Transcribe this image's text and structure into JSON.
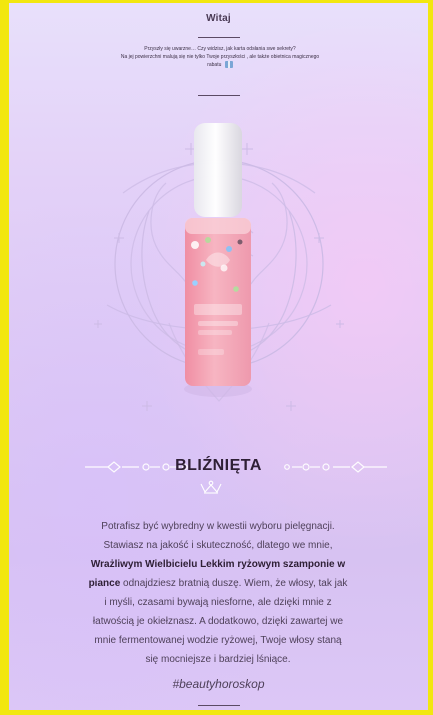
{
  "email": {
    "title": "Witaj",
    "intro_line1": "Przyszły się uwarzne… Czy widzisz, jak karta odsłania swe sekrety?",
    "intro_line2": "Na jej powierzchni malują się nie tylko Twoje przyszłości , ale także obietnica magicznego",
    "intro_line3": "rabatu",
    "sign": "BLIŹNIĘTA",
    "body": [
      "Potrafisz być wybredny w kwestii wyboru pielęgnacji.",
      "Stawiasz na jakość i skuteczność, dlatego we mnie,",
      "Wrażliwym Wielbicielu Lekkim ryżowym szamponie w",
      "piance",
      "odnajdziesz bratnią duszę. Wiem, że włosy, tak jak",
      "i myśli, czasami bywają niesforne, ale dzięki mnie z",
      "łatwością je okiełznasz. A dodatkowo, dzięki zawartej we",
      "mnie fermentowanej wodzie ryżowej, Twoje włosy staną",
      "się mocniejsze i bardziej lśniące."
    ],
    "hashtag": "#beautyhoroskop"
  },
  "colors": {
    "outer_background": "#f2e70f",
    "card_background": "#e2d3f8",
    "text_primary": "#2f2036",
    "text_secondary": "#4f415a",
    "bottle_pink": "#f4a7b4"
  },
  "icons": {
    "gift": "gift-emoji-icon",
    "ornament": "zodiac-ornament-icon",
    "crown": "crown-ornament-icon"
  }
}
